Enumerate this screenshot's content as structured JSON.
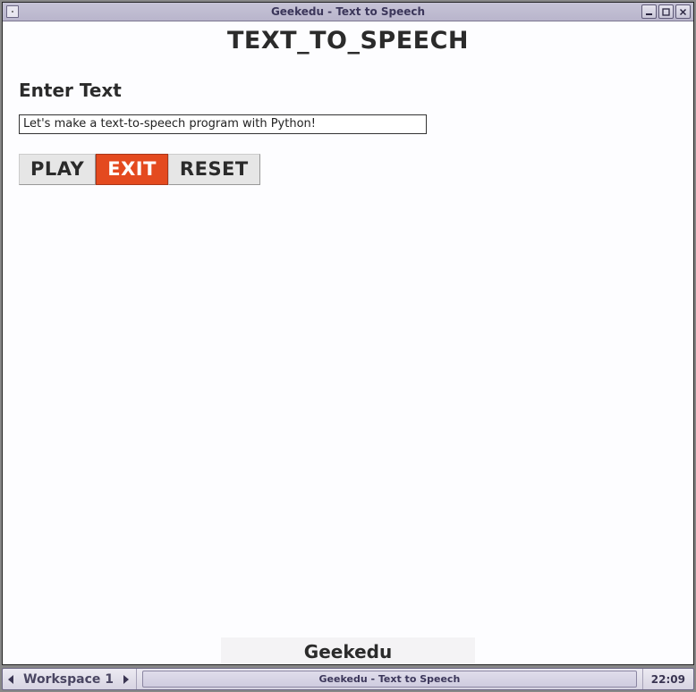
{
  "window": {
    "title": "Geekedu - Text to Speech"
  },
  "app": {
    "heading": "TEXT_TO_SPEECH",
    "input_label": "Enter Text",
    "input_value": "Let's make a text-to-speech program with Python!",
    "buttons": {
      "play": "PLAY",
      "exit": "EXIT",
      "reset": "RESET"
    },
    "footer_brand": "Geekedu"
  },
  "taskbar": {
    "workspace_label": "Workspace 1",
    "entry": "Geekedu - Text to Speech",
    "clock": "22:09"
  }
}
